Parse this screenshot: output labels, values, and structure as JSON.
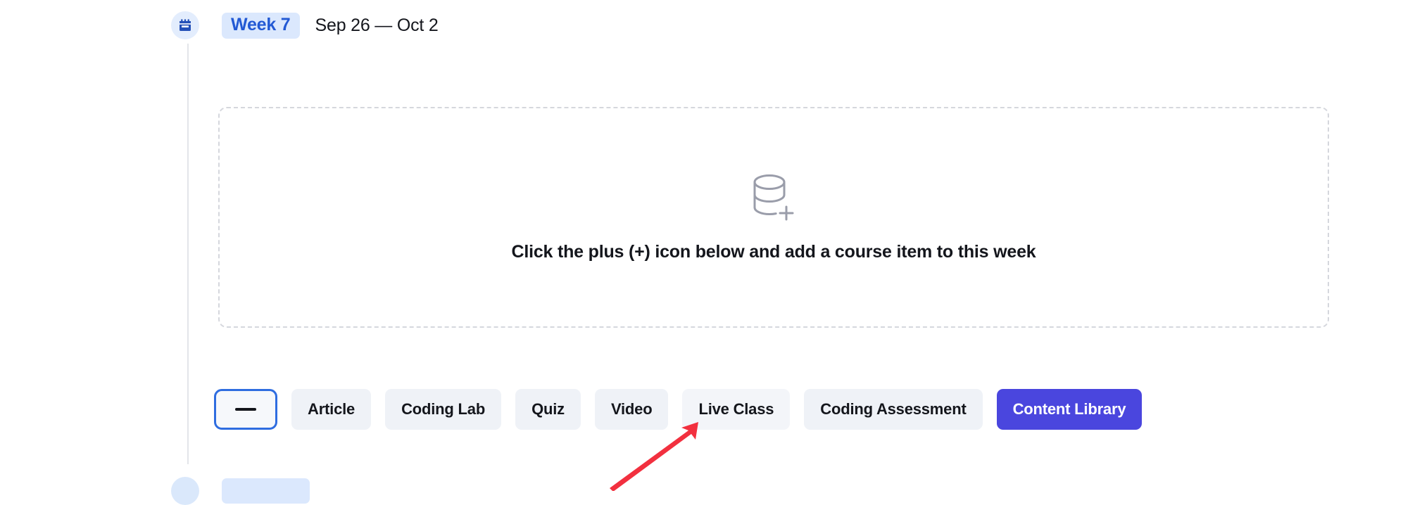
{
  "week": {
    "icon": "calendar-icon",
    "badge_label": "Week 7",
    "date_range": "Sep 26 — Oct 2"
  },
  "dropzone": {
    "icon": "database-plus-icon",
    "message": "Click the plus (+) icon below and add a course item to this week"
  },
  "actions": {
    "toggle": {
      "icon": "minus-icon",
      "label": ""
    },
    "items": [
      {
        "label": "Article",
        "name": "add-article-button",
        "style": "default"
      },
      {
        "label": "Coding Lab",
        "name": "add-coding-lab-button",
        "style": "default"
      },
      {
        "label": "Quiz",
        "name": "add-quiz-button",
        "style": "default"
      },
      {
        "label": "Video",
        "name": "add-video-button",
        "style": "default"
      },
      {
        "label": "Live Class",
        "name": "add-live-class-button",
        "style": "hovered"
      },
      {
        "label": "Coding Assessment",
        "name": "add-coding-assessment-button",
        "style": "default"
      },
      {
        "label": "Content Library",
        "name": "content-library-button",
        "style": "primary"
      }
    ]
  },
  "annotation": {
    "type": "arrow",
    "color": "#f2303f",
    "points_to": "Live Class"
  },
  "colors": {
    "accent_blue": "#2259d4",
    "badge_bg": "#dbe8fd",
    "chip_bg": "#eff2f7",
    "primary_button_bg": "#4a46de",
    "focus_ring": "#2f6de0",
    "text": "#14161c",
    "dashed_border": "#d5d7dd",
    "rail": "#e3e5e9",
    "annotation_red": "#f2303f"
  }
}
